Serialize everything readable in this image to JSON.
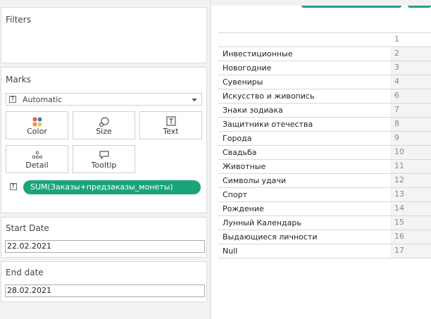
{
  "filters": {
    "title": "Filters"
  },
  "marks": {
    "title": "Marks",
    "type_icon": "text-mark-icon",
    "type_value": "Automatic",
    "buttons": [
      {
        "label": "Color",
        "icon": "color-dots-icon"
      },
      {
        "label": "Size",
        "icon": "size-icon"
      },
      {
        "label": "Text",
        "icon": "text-icon"
      },
      {
        "label": "Detail",
        "icon": "detail-icon"
      },
      {
        "label": "Tooltip",
        "icon": "tooltip-icon"
      }
    ],
    "pill_label": "SUM(Заказы+предзаказы_монеты)",
    "pill_color": "#1aa479"
  },
  "start_date": {
    "title": "Start Date",
    "value": "22.02.2021"
  },
  "end_date": {
    "title": "End date",
    "value": "28.02.2021"
  },
  "table": {
    "header_value": "1",
    "rows": [
      {
        "name": "Инвестиционные",
        "value": "2"
      },
      {
        "name": "Новогодние",
        "value": "3"
      },
      {
        "name": "Сувениры",
        "value": "4"
      },
      {
        "name": "Искусство и живопись",
        "value": "6"
      },
      {
        "name": "Знаки зодиака",
        "value": "7"
      },
      {
        "name": "Защитники отечества",
        "value": "8"
      },
      {
        "name": "Города",
        "value": "9"
      },
      {
        "name": "Свадьба",
        "value": "10"
      },
      {
        "name": "Животные",
        "value": "11"
      },
      {
        "name": "Символы удачи",
        "value": "12"
      },
      {
        "name": "Спорт",
        "value": "13"
      },
      {
        "name": "Рождение",
        "value": "14"
      },
      {
        "name": "Лунный Календарь",
        "value": "15"
      },
      {
        "name": "Выдающиеся личности",
        "value": "16"
      },
      {
        "name": "Null",
        "value": "17"
      }
    ]
  },
  "colors": {
    "accent": "#1aa479",
    "tab": "#2b9a86"
  }
}
